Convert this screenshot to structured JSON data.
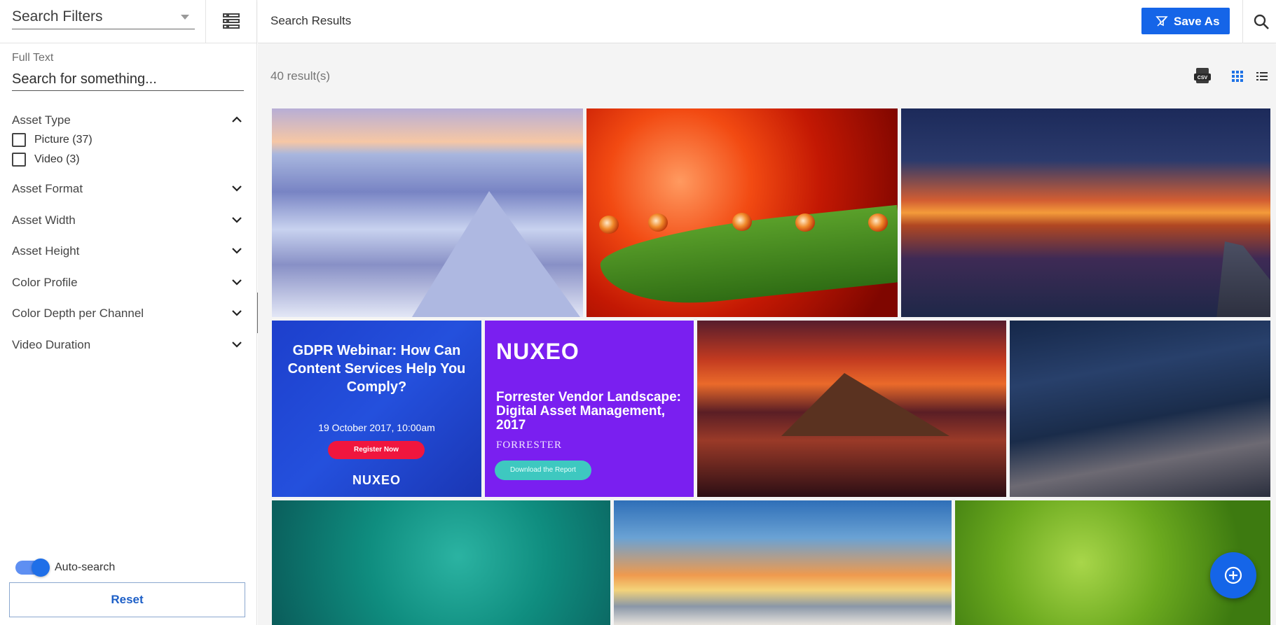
{
  "sidebar": {
    "filter_select": "Search Filters",
    "fulltext": {
      "label": "Full Text",
      "placeholder": "Search for something..."
    },
    "asset_type": {
      "label": "Asset Type",
      "options": [
        {
          "label": "Picture (37)"
        },
        {
          "label": "Video (3)"
        }
      ]
    },
    "facets": [
      {
        "label": "Asset Format"
      },
      {
        "label": "Asset Width"
      },
      {
        "label": "Asset Height"
      },
      {
        "label": "Color Profile"
      },
      {
        "label": "Color Depth per Channel"
      },
      {
        "label": "Video Duration"
      }
    ],
    "auto_search_label": "Auto-search",
    "reset_label": "Reset"
  },
  "header": {
    "title": "Search Results",
    "save_as_label": "Save As"
  },
  "results": {
    "count": "40 result(s)",
    "ad1": {
      "title": "GDPR Webinar: How Can Content Services Help You Comply?",
      "date": "19 October 2017, 10:00am",
      "cta": "Register Now",
      "logo": "NUXEO"
    },
    "ad2": {
      "logo": "NUXEO",
      "title": "Forrester Vendor Landscape: Digital Asset Management, 2017",
      "brand": "FORRESTER",
      "cta": "Download the Report"
    }
  },
  "colors": {
    "accent": "#1565e8",
    "sidebar_bg": "#ffffff",
    "results_bg": "#f4f4f4"
  },
  "icons": [
    "saved-search-list-icon",
    "search-icon",
    "save-as-icon",
    "csv-export-icon",
    "grid-view-icon",
    "list-view-icon",
    "chevron-up-icon",
    "chevron-down-icon",
    "add-circle-icon",
    "collapse-left-icon"
  ]
}
